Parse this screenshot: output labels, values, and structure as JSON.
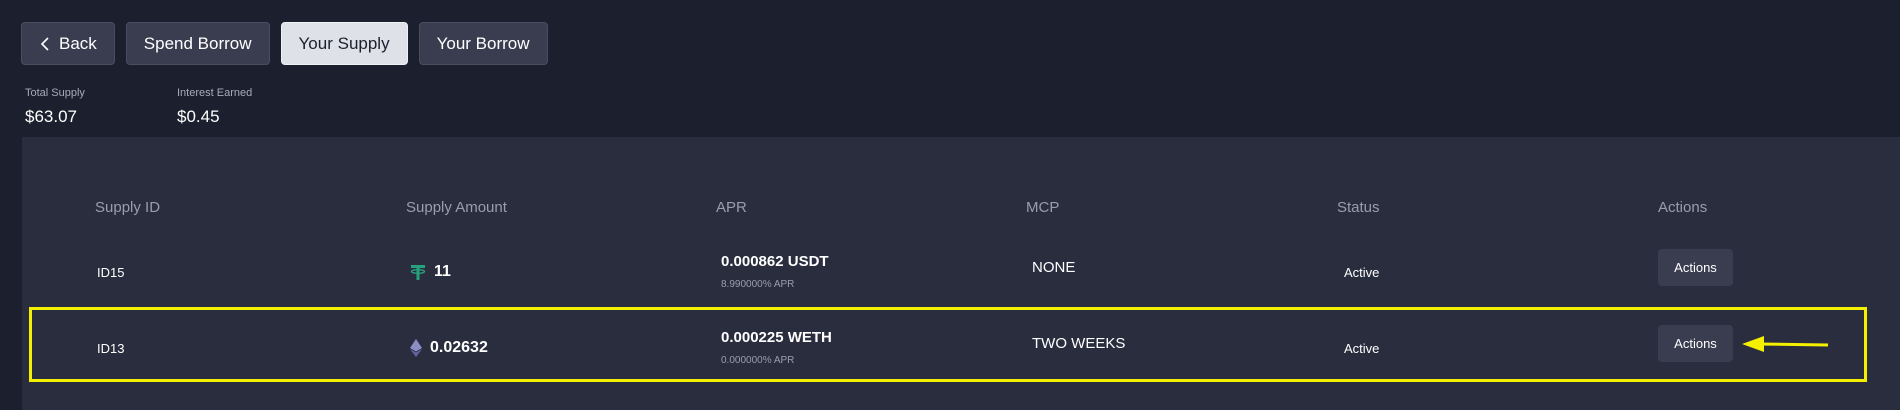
{
  "toolbar": {
    "tabs": [
      {
        "label": "Back",
        "icon": "chevron-left-icon"
      },
      {
        "label": "Spend Borrow"
      },
      {
        "label": "Your Supply",
        "active": true
      },
      {
        "label": "Your Borrow"
      }
    ]
  },
  "stats": [
    {
      "label": "Total Supply",
      "value": "$63.07"
    },
    {
      "label": "Interest Earned",
      "value": "$0.45"
    }
  ],
  "table": {
    "headers": [
      "Supply ID",
      "Supply Amount",
      "APR",
      "MCP",
      "Status",
      "Actions"
    ],
    "rows": [
      {
        "id": "ID15",
        "token_icon": "usdt-icon",
        "amount": "11",
        "apr": "0.000862 USDT",
        "apr_rate": "8.990000% APR",
        "mcp": "NONE",
        "status": "Active",
        "action": "Actions"
      },
      {
        "id": "ID13",
        "token_icon": "eth-icon",
        "amount": "0.02632",
        "apr": "0.000225 WETH",
        "apr_rate": "0.000000% APR",
        "mcp": "TWO WEEKS",
        "status": "Active",
        "action": "Actions",
        "highlighted": true
      }
    ]
  },
  "colors": {
    "background": "#1c1f2e",
    "panel": "#2a2d3e",
    "button": "#3a3d50",
    "active_tab": "#dfe1e8",
    "usdt": "#26a17b",
    "highlight": "#f5f000"
  }
}
